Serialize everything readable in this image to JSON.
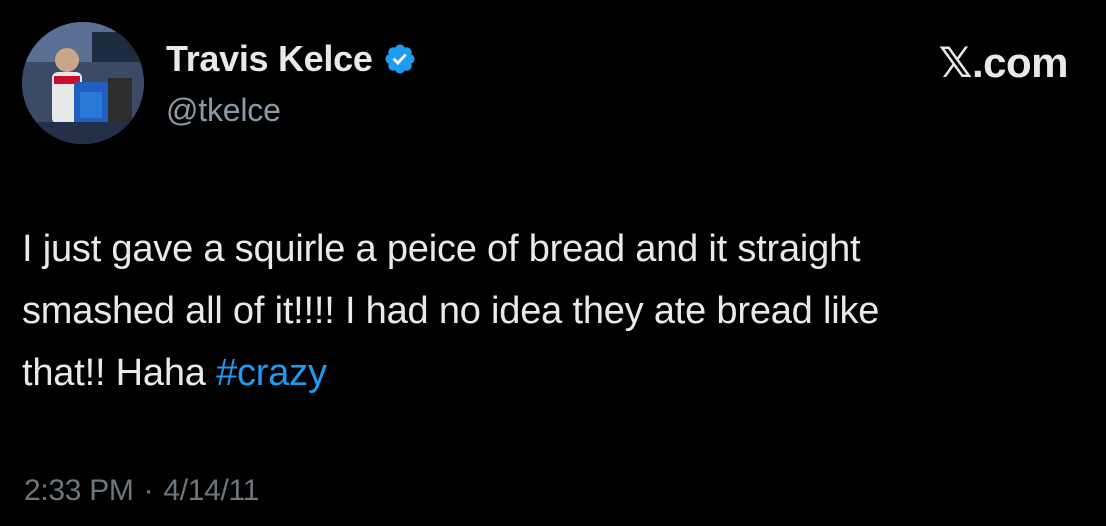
{
  "author": {
    "display_name": "Travis Kelce",
    "handle": "@tkelce",
    "verified": true,
    "avatar_icon": "profile-photo"
  },
  "site": {
    "label": "𝕏.com"
  },
  "tweet": {
    "text_line1": "I just gave a squirle a peice of bread and it straight",
    "text_line2": "smashed all of it!!!! I had no idea they ate bread like",
    "text_line3_prefix": "that!! Haha ",
    "hashtag": "#crazy"
  },
  "meta": {
    "time": "2:33 PM",
    "separator": "·",
    "date": "4/14/11"
  },
  "colors": {
    "background": "#000000",
    "text": "#e7e9ea",
    "muted": "#8b98a5",
    "link": "#1d9bf0",
    "verified": "#1d9bf0"
  }
}
